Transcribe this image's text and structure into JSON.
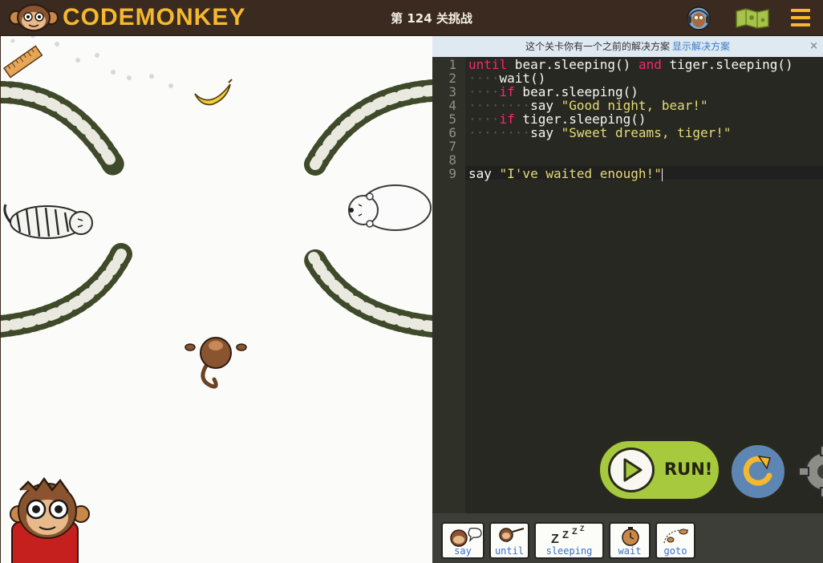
{
  "app": {
    "logo_text": "CODEMONKEY"
  },
  "header": {
    "level_title": "第 124 关挑战"
  },
  "notice": {
    "text": "这个关卡你有一个之前的解决方案",
    "link": "显示解决方案",
    "close": "×"
  },
  "editor": {
    "line_numbers": [
      "1",
      "2",
      "3",
      "4",
      "5",
      "6",
      "7",
      "8",
      "9"
    ]
  },
  "code": {
    "l1_kw1": "until",
    "l1_a": " bear.sleeping() ",
    "l1_kw2": "and",
    "l1_b": " tiger.sleeping()",
    "l2": "wait()",
    "l3_kw": "if",
    "l3_a": " bear.sleeping()",
    "l4_a": "say ",
    "l4_str": "\"Good night, bear!\"",
    "l5_kw": "if",
    "l5_a": " tiger.sleeping()",
    "l6_a": "say ",
    "l6_str": "\"Sweet dreams, tiger!\"",
    "l9_a": "say ",
    "l9_str": "\"I've waited enough!\""
  },
  "controls": {
    "run_label": "RUN!"
  },
  "toolbar": {
    "chips": [
      "say",
      "until",
      "sleeping",
      "wait",
      "goto"
    ]
  },
  "game": {
    "characters": [
      "tiger",
      "polar-bear",
      "monkey",
      "banana",
      "ruler",
      "monkey-guide"
    ]
  },
  "colors": {
    "accent": "#f5b82e",
    "run_green": "#a6c93e",
    "reset_blue": "#5d86b5",
    "keyword": "#f92672",
    "string": "#e6db74"
  }
}
